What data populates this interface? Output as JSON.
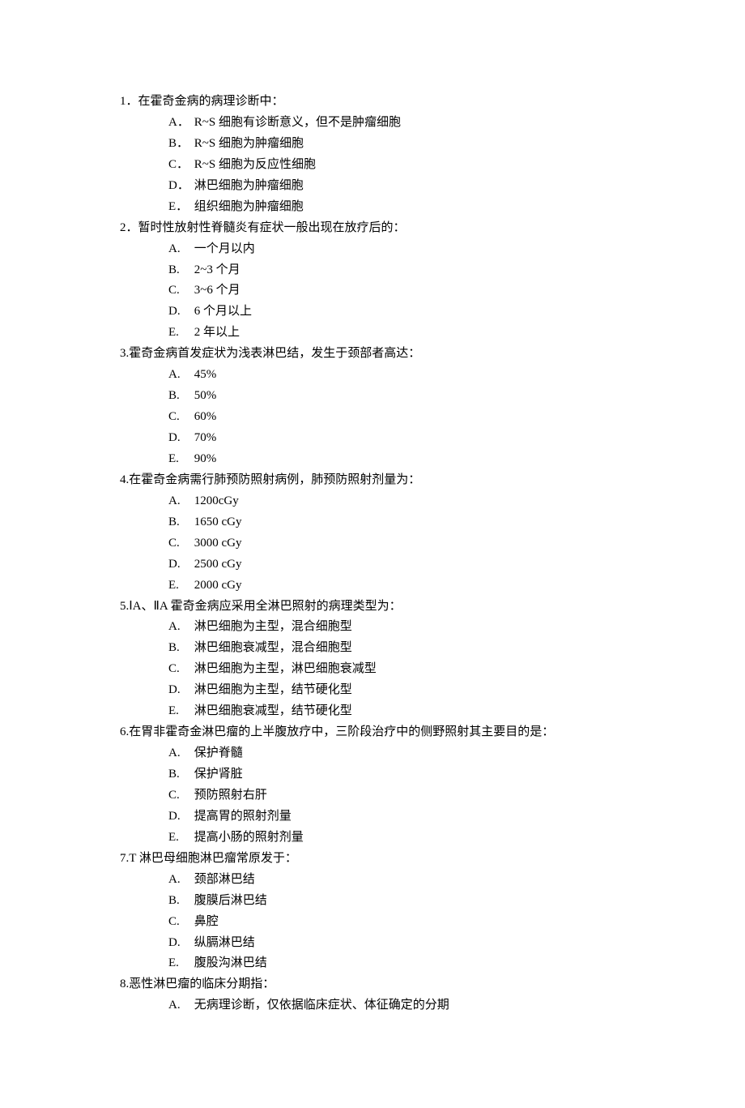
{
  "questions": [
    {
      "number": "1．",
      "text": "在霍奇金病的病理诊断中：",
      "options": [
        {
          "label": "A．",
          "text": "R~S 细胞有诊断意义，但不是肿瘤细胞"
        },
        {
          "label": "B．",
          "text": "R~S 细胞为肿瘤细胞"
        },
        {
          "label": "C．",
          "text": "R~S 细胞为反应性细胞"
        },
        {
          "label": "D．",
          "text": "淋巴细胞为肿瘤细胞"
        },
        {
          "label": "E．",
          "text": "组织细胞为肿瘤细胞"
        }
      ]
    },
    {
      "number": "2．",
      "text": "暂时性放射性脊髓炎有症状一般出现在放疗后的：",
      "options": [
        {
          "label": "A.",
          "text": "一个月以内"
        },
        {
          "label": "B.",
          "text": "2~3 个月"
        },
        {
          "label": "C.",
          "text": "3~6 个月"
        },
        {
          "label": "D.",
          "text": "6 个月以上"
        },
        {
          "label": "E.",
          "text": "2 年以上"
        }
      ]
    },
    {
      "number": "3.",
      "text": "霍奇金病首发症状为浅表淋巴结，发生于颈部者高达：",
      "options": [
        {
          "label": "A.",
          "text": "45%"
        },
        {
          "label": "B.",
          "text": "50%"
        },
        {
          "label": "C.",
          "text": "60%"
        },
        {
          "label": "D.",
          "text": "70%"
        },
        {
          "label": "E.",
          "text": "90%"
        }
      ]
    },
    {
      "number": "4.",
      "text": "在霍奇金病需行肺预防照射病例，肺预防照射剂量为：",
      "options": [
        {
          "label": "A.",
          "text": "1200cGy"
        },
        {
          "label": "B.",
          "text": "1650 cGy"
        },
        {
          "label": "C.",
          "text": "3000 cGy"
        },
        {
          "label": "D.",
          "text": "2500 cGy"
        },
        {
          "label": "E.",
          "text": "2000 cGy"
        }
      ]
    },
    {
      "number": "5.",
      "text": "ⅠA、ⅡA 霍奇金病应采用全淋巴照射的病理类型为：",
      "options": [
        {
          "label": "A.",
          "text": "淋巴细胞为主型，混合细胞型"
        },
        {
          "label": "B.",
          "text": "淋巴细胞衰减型，混合细胞型"
        },
        {
          "label": "C.",
          "text": "淋巴细胞为主型，淋巴细胞衰减型"
        },
        {
          "label": "D.",
          "text": "淋巴细胞为主型，结节硬化型"
        },
        {
          "label": "E.",
          "text": "淋巴细胞衰减型，结节硬化型"
        }
      ]
    },
    {
      "number": "6.",
      "text": "在胃非霍奇金淋巴瘤的上半腹放疗中，三阶段治疗中的侧野照射其主要目的是：",
      "options": [
        {
          "label": "A.",
          "text": "保护脊髓"
        },
        {
          "label": "B.",
          "text": "保护肾脏"
        },
        {
          "label": "C.",
          "text": "预防照射右肝"
        },
        {
          "label": "D.",
          "text": "提高胃的照射剂量"
        },
        {
          "label": "E.",
          "text": "提高小肠的照射剂量"
        }
      ]
    },
    {
      "number": "7.",
      "text": "T 淋巴母细胞淋巴瘤常原发于：",
      "options": [
        {
          "label": "A.",
          "text": "颈部淋巴结"
        },
        {
          "label": "B.",
          "text": "腹膜后淋巴结"
        },
        {
          "label": "C.",
          "text": "鼻腔"
        },
        {
          "label": "D.",
          "text": "纵膈淋巴结"
        },
        {
          "label": "E.",
          "text": "腹股沟淋巴结"
        }
      ]
    },
    {
      "number": "8.",
      "text": "恶性淋巴瘤的临床分期指：",
      "options": [
        {
          "label": "A.",
          "text": "无病理诊断，仅依据临床症状、体征确定的分期"
        }
      ]
    }
  ]
}
